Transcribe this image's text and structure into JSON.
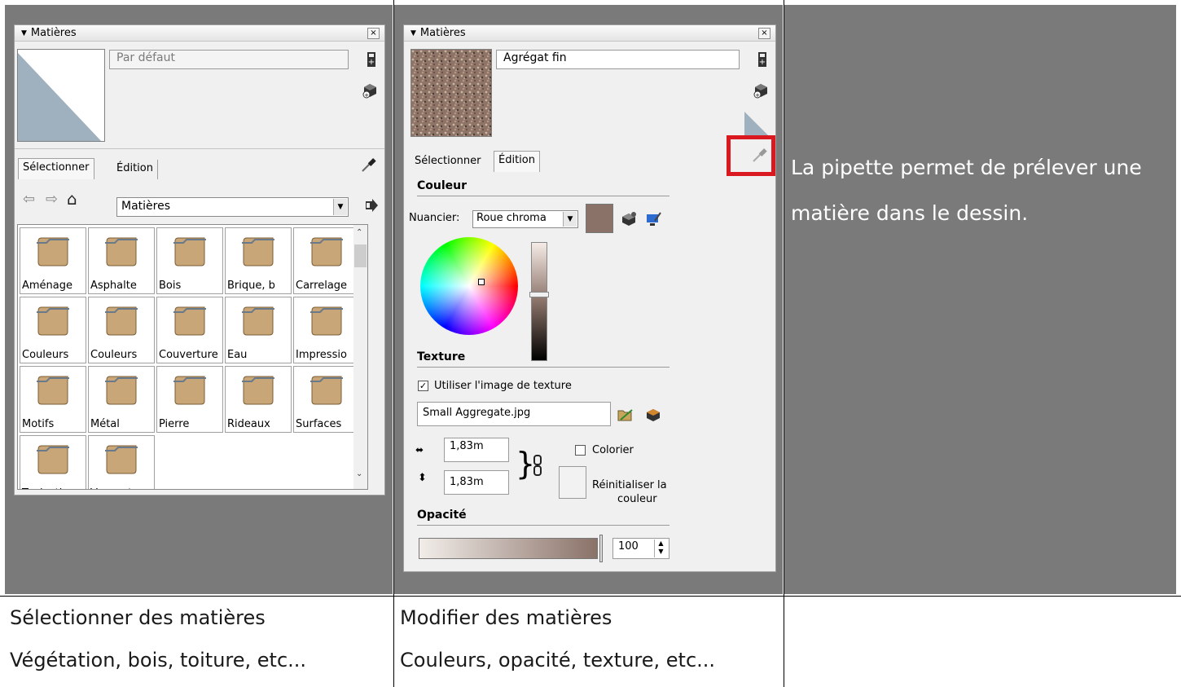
{
  "left_panel": {
    "title": "Matières",
    "close_label": "×",
    "material_name_placeholder": "Par défaut",
    "tabs": [
      "Sélectionner",
      "Édition"
    ],
    "library_select": "Matières",
    "library_items": [
      "Aménage",
      "Asphalte",
      "Bois",
      "Brique, b",
      "Carrelage",
      "Couleurs",
      "Couleurs",
      "Couverture",
      "Eau",
      "Impressio",
      "Motifs",
      "Métal",
      "Pierre",
      "Rideaux",
      "Surfaces",
      "Tapis, tis",
      "Verre et"
    ]
  },
  "right_panel": {
    "title": "Matières",
    "close_label": "×",
    "material_name": "Agrégat fin",
    "tabs": [
      "Sélectionner",
      "Édition"
    ],
    "couleur_heading": "Couleur",
    "nuancier_label": "Nuancier:",
    "nuancier_value": "Roue chroma",
    "current_color": "#8a7268",
    "texture_heading": "Texture",
    "use_texture_label": "Utiliser l'image de texture",
    "use_texture_checked": true,
    "texture_file": "Small Aggregate.jpg",
    "width_value": "1,83m",
    "height_value": "1,83m",
    "colorize_label": "Colorier",
    "reset_color_label_1": "Réinitialiser la",
    "reset_color_label_2": "couleur",
    "opacity_heading": "Opacité",
    "opacity_value": "100"
  },
  "note_text": "La pipette permet de prélever une matière dans le dessin.",
  "captions": {
    "select_title": "Sélectionner des matières",
    "select_desc": "Végétation, bois, toiture, etc...",
    "edit_title": "Modifier des matières",
    "edit_desc": "Couleurs, opacité, texture, etc..."
  },
  "colors": {
    "background_cell": "#7a7a7a",
    "highlight": "#d9191f",
    "folder": "#c8a678"
  }
}
